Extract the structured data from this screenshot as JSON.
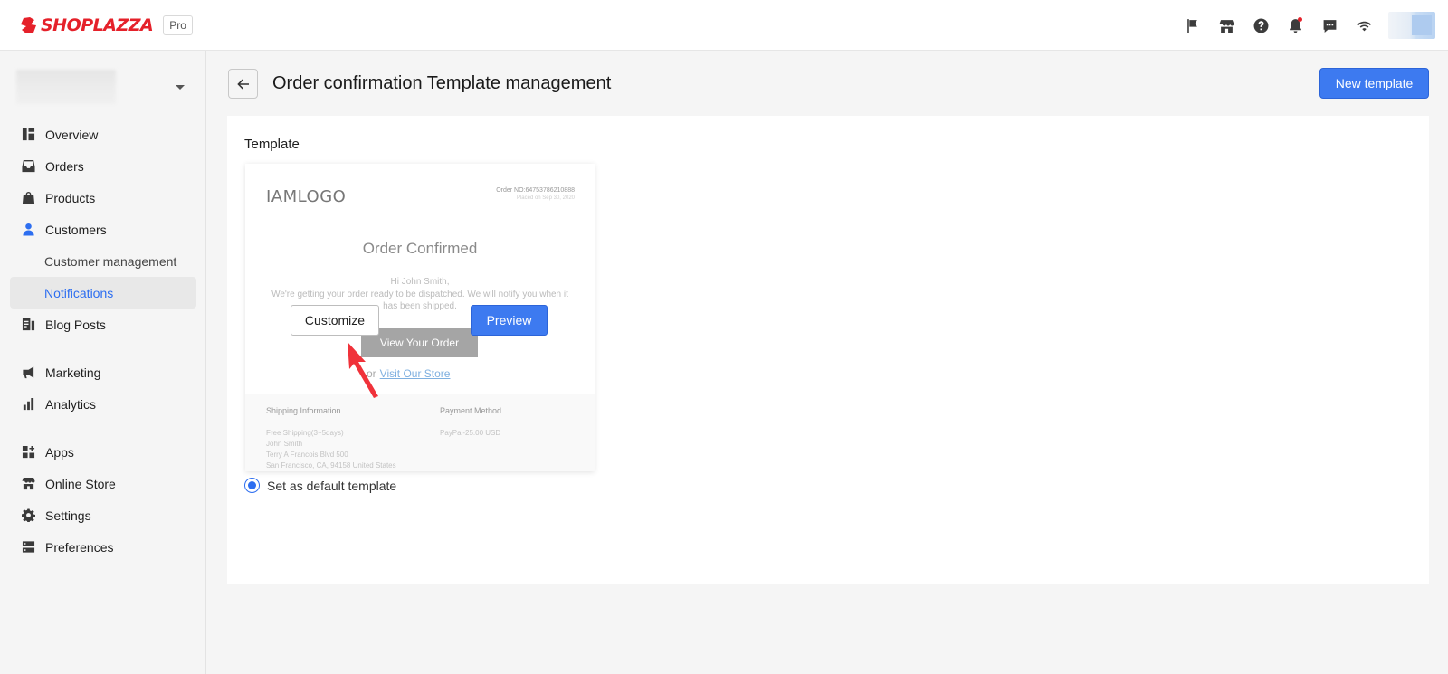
{
  "brand": {
    "logo_text": "SHOPLAZZA",
    "badge": "Pro",
    "color": "#e5212a"
  },
  "topbar_icons": [
    "flag-icon",
    "store-icon",
    "help-icon",
    "bell-icon",
    "message-icon",
    "wifi-icon"
  ],
  "sidebar": {
    "items": [
      {
        "label": "Overview",
        "icon": "overview-icon"
      },
      {
        "label": "Orders",
        "icon": "inbox-icon"
      },
      {
        "label": "Products",
        "icon": "bag-icon"
      },
      {
        "label": "Customers",
        "icon": "person-icon"
      },
      {
        "label": "Customer management"
      },
      {
        "label": "Notifications"
      },
      {
        "label": "Blog Posts",
        "icon": "blog-icon"
      },
      {
        "label": "Marketing",
        "icon": "megaphone-icon"
      },
      {
        "label": "Analytics",
        "icon": "bar-chart-icon"
      },
      {
        "label": "Apps",
        "icon": "apps-icon"
      },
      {
        "label": "Online Store",
        "icon": "store-icon"
      },
      {
        "label": "Settings",
        "icon": "gear-icon"
      },
      {
        "label": "Preferences",
        "icon": "preferences-icon"
      }
    ]
  },
  "header": {
    "title": "Order confirmation Template management",
    "new_button": "New template"
  },
  "card": {
    "label": "Template",
    "preview": {
      "logo": "IAMLOGO",
      "order_no": "Order NO:64753786210888",
      "placed_on": "Placed on Sep 30, 2020",
      "heading": "Order Confirmed",
      "greeting": "Hi  John Smith,",
      "message": "We're getting your order ready to be dispatched. We will notify you when it has been shipped.",
      "view_order": "View Your Order",
      "or": "or",
      "visit_store": "Visit Our Store",
      "shipping_title": "Shipping Information",
      "shipping_lines": [
        "Free Shipping(3~5days)",
        "John Smith",
        "Terry A Francois Blvd 500",
        "San Francisco,  CA,  94158 United States"
      ],
      "payment_title": "Payment Method",
      "payment_line": "PayPal-25.00 USD"
    },
    "customize_button": "Customize",
    "preview_button": "Preview",
    "default_label": "Set as default template",
    "default_checked": true
  },
  "colors": {
    "primary": "#3d7af0",
    "active_nav": "#2d6ef0",
    "annotation_arrow": "#f0323a"
  }
}
